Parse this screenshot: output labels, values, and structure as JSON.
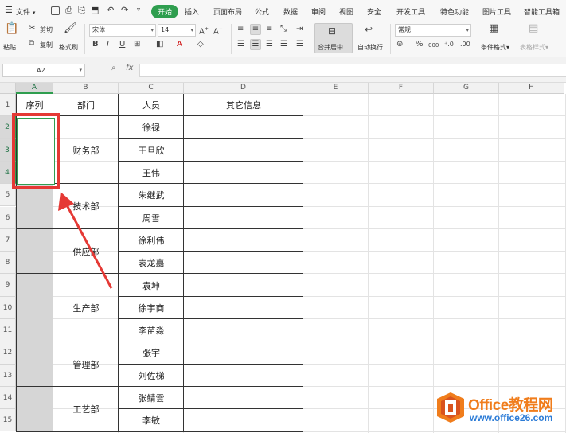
{
  "menubar": {
    "file_label": "文件",
    "tabs": [
      {
        "label": "开始",
        "active": true
      },
      {
        "label": "插入"
      },
      {
        "label": "页面布局"
      },
      {
        "label": "公式"
      },
      {
        "label": "数据"
      },
      {
        "label": "审阅"
      },
      {
        "label": "视图"
      },
      {
        "label": "安全"
      },
      {
        "label": "开发工具"
      },
      {
        "label": "特色功能"
      },
      {
        "label": "图片工具"
      },
      {
        "label": "智能工具箱"
      }
    ]
  },
  "ribbon": {
    "paste": "粘贴",
    "cut": "剪切",
    "copy": "复制",
    "format_painter": "格式刷",
    "font_name": "宋体",
    "font_size": "14",
    "merge_center": "合并居中",
    "wrap_text": "自动换行",
    "number_format": "常规",
    "percent": "%",
    "thousands": "000",
    "cond_format": "条件格式",
    "table_style": "表格样式",
    "bold": "B",
    "italic": "I",
    "underline": "U"
  },
  "formula_bar": {
    "cell_ref": "A2",
    "fx": "fx",
    "zoom_icon": "magnifier-icon",
    "content": ""
  },
  "sheet": {
    "columns": [
      "A",
      "B",
      "C",
      "D",
      "E",
      "F",
      "G",
      "H"
    ],
    "selected_column": "A",
    "rows": [
      "1",
      "2",
      "3",
      "4",
      "5",
      "6",
      "7",
      "8",
      "9",
      "10",
      "11",
      "12",
      "13",
      "14",
      "15"
    ],
    "selected_rows": [
      "2",
      "3",
      "4"
    ],
    "headers": {
      "a": "序列",
      "b": "部门",
      "c": "人员",
      "d": "其它信息"
    },
    "departments": [
      {
        "name": "财务部",
        "people": [
          "徐禄",
          "王旦欣",
          "王伟"
        ]
      },
      {
        "name": "技术部",
        "people": [
          "朱继武",
          "周雪"
        ]
      },
      {
        "name": "供应部",
        "people": [
          "徐利伟",
          "袁龙嘉"
        ]
      },
      {
        "name": "生产部",
        "people": [
          "袁坤",
          "徐宇商",
          "李苗淼"
        ]
      },
      {
        "name": "管理部",
        "people": [
          "张宇",
          "刘佐梯"
        ]
      },
      {
        "name": "工艺部",
        "people": [
          "张鲭雲",
          "李敏"
        ]
      }
    ]
  },
  "colors": {
    "accent": "#2f9e4f",
    "annotation": "#e53935",
    "merged_fill": "#d6d6d6",
    "watermark_orange": "#f07d1c",
    "watermark_blue": "#2b7bd6"
  },
  "watermark": {
    "title": "Office教程网",
    "url": "www.office26.com"
  }
}
